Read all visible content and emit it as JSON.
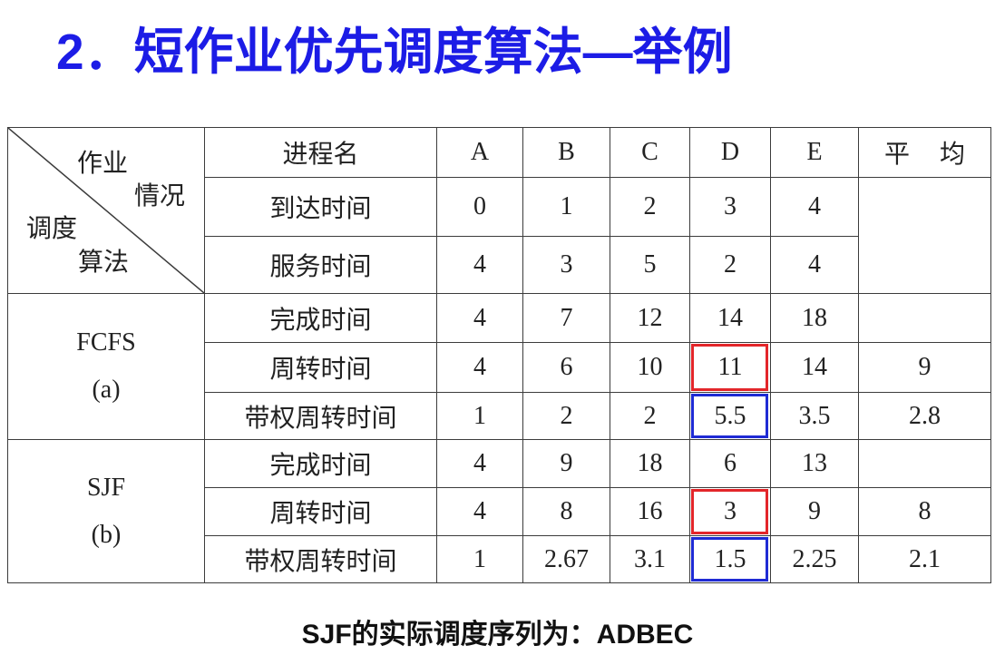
{
  "slide": {
    "title": "2．短作业优先调度算法—举例",
    "footer": "SJF的实际调度序列为：ADBEC"
  },
  "colors": {
    "title": "#1c1ce6",
    "turnaround_box": "#e3262a",
    "weighted_box": "#1f2bd4"
  },
  "table": {
    "corner": {
      "upper": [
        "作业",
        "情况"
      ],
      "lower": [
        "调度",
        "算法"
      ]
    },
    "header": {
      "label": "进程名",
      "processes": [
        "A",
        "B",
        "C",
        "D",
        "E"
      ],
      "average": "平 均"
    },
    "input_rows": [
      {
        "label": "到达时间",
        "values": [
          0,
          1,
          2,
          3,
          4
        ]
      },
      {
        "label": "服务时间",
        "values": [
          4,
          3,
          5,
          2,
          4
        ]
      }
    ],
    "algorithms": [
      {
        "name": "FCFS",
        "tag": "(a)",
        "rows": [
          {
            "label": "完成时间",
            "values": [
              4,
              7,
              12,
              14,
              18
            ]
          },
          {
            "label": "周转时间",
            "values": [
              4,
              6,
              10,
              11,
              14
            ],
            "average": 9
          },
          {
            "label": "带权周转时间",
            "values": [
              1,
              2,
              2,
              5.5,
              3.5
            ],
            "average": 2.8
          }
        ]
      },
      {
        "name": "SJF",
        "tag": "(b)",
        "rows": [
          {
            "label": "完成时间",
            "values": [
              4,
              9,
              18,
              6,
              13
            ]
          },
          {
            "label": "周转时间",
            "values": [
              4,
              8,
              16,
              3,
              9
            ],
            "average": 8
          },
          {
            "label": "带权周转时间",
            "values": [
              1,
              2.67,
              3.1,
              1.5,
              2.25
            ],
            "average": 2.1
          }
        ]
      }
    ]
  }
}
